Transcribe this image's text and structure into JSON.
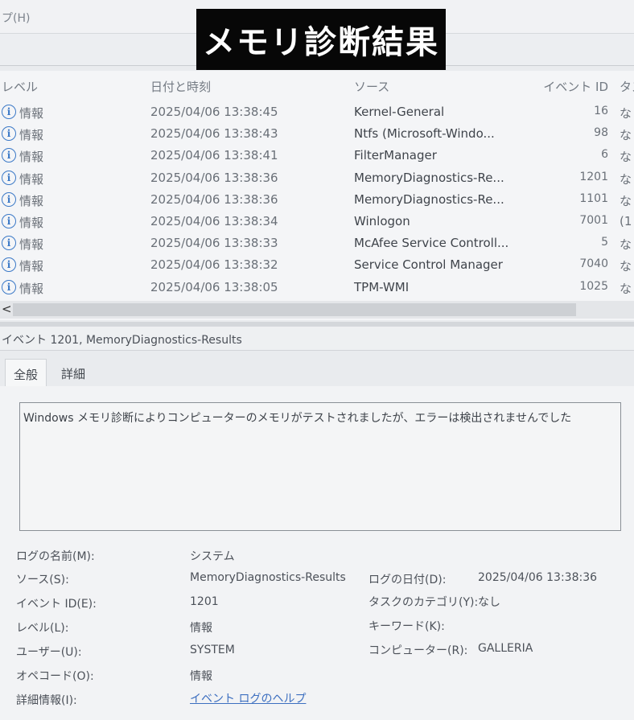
{
  "menu": {
    "help_label": "プ(H)"
  },
  "overlay": {
    "title": "メモリ診断結果"
  },
  "event_list": {
    "columns": {
      "level": "レベル",
      "datetime": "日付と時刻",
      "source": "ソース",
      "event_id": "イベント ID",
      "task": "タス"
    },
    "rows": [
      {
        "level": "情報",
        "datetime": "2025/04/06 13:38:45",
        "source": "Kernel-General",
        "event_id": "16",
        "task": "な"
      },
      {
        "level": "情報",
        "datetime": "2025/04/06 13:38:43",
        "source": "Ntfs (Microsoft-Windo...",
        "event_id": "98",
        "task": "な"
      },
      {
        "level": "情報",
        "datetime": "2025/04/06 13:38:41",
        "source": "FilterManager",
        "event_id": "6",
        "task": "な"
      },
      {
        "level": "情報",
        "datetime": "2025/04/06 13:38:36",
        "source": "MemoryDiagnostics-Re...",
        "event_id": "1201",
        "task": "な"
      },
      {
        "level": "情報",
        "datetime": "2025/04/06 13:38:36",
        "source": "MemoryDiagnostics-Re...",
        "event_id": "1101",
        "task": "な"
      },
      {
        "level": "情報",
        "datetime": "2025/04/06 13:38:34",
        "source": "Winlogon",
        "event_id": "7001",
        "task": "(1"
      },
      {
        "level": "情報",
        "datetime": "2025/04/06 13:38:33",
        "source": "McAfee Service Controll...",
        "event_id": "5",
        "task": "な"
      },
      {
        "level": "情報",
        "datetime": "2025/04/06 13:38:32",
        "source": "Service Control Manager",
        "event_id": "7040",
        "task": "な"
      },
      {
        "level": "情報",
        "datetime": "2025/04/06 13:38:05",
        "source": "TPM-WMI",
        "event_id": "1025",
        "task": "な"
      }
    ],
    "info_icon_glyph": "i",
    "scroll_left_glyph": "<"
  },
  "detail": {
    "title": "イベント 1201, MemoryDiagnostics-Results",
    "tabs": {
      "general": "全般",
      "details": "詳細"
    },
    "description": "Windows メモリ診断によりコンピューターのメモリがテストされましたが、エラーは検出されませんでした",
    "props": {
      "log_name_label": "ログの名前(M):",
      "log_name": "システム",
      "source_label": "ソース(S):",
      "source": "MemoryDiagnostics-Results",
      "logged_label": "ログの日付(D):",
      "logged": "2025/04/06 13:38:36",
      "event_id_label": "イベント ID(E):",
      "event_id": "1201",
      "task_category_label": "タスクのカテゴリ(Y):",
      "task_category": "なし",
      "level_label": "レベル(L):",
      "level": "情報",
      "keywords_label": "キーワード(K):",
      "keywords": "",
      "user_label": "ユーザー(U):",
      "user": "SYSTEM",
      "computer_label": "コンピューター(R):",
      "computer": "GALLERIA",
      "opcode_label": "オペコード(O):",
      "opcode": "情報",
      "more_info_label": "詳細情報(I):",
      "more_info_link": "イベント ログのヘルプ"
    }
  },
  "colors": {
    "info_icon": "#3b79c7",
    "link": "#3d6fc0",
    "overlay_bg": "#070707"
  }
}
